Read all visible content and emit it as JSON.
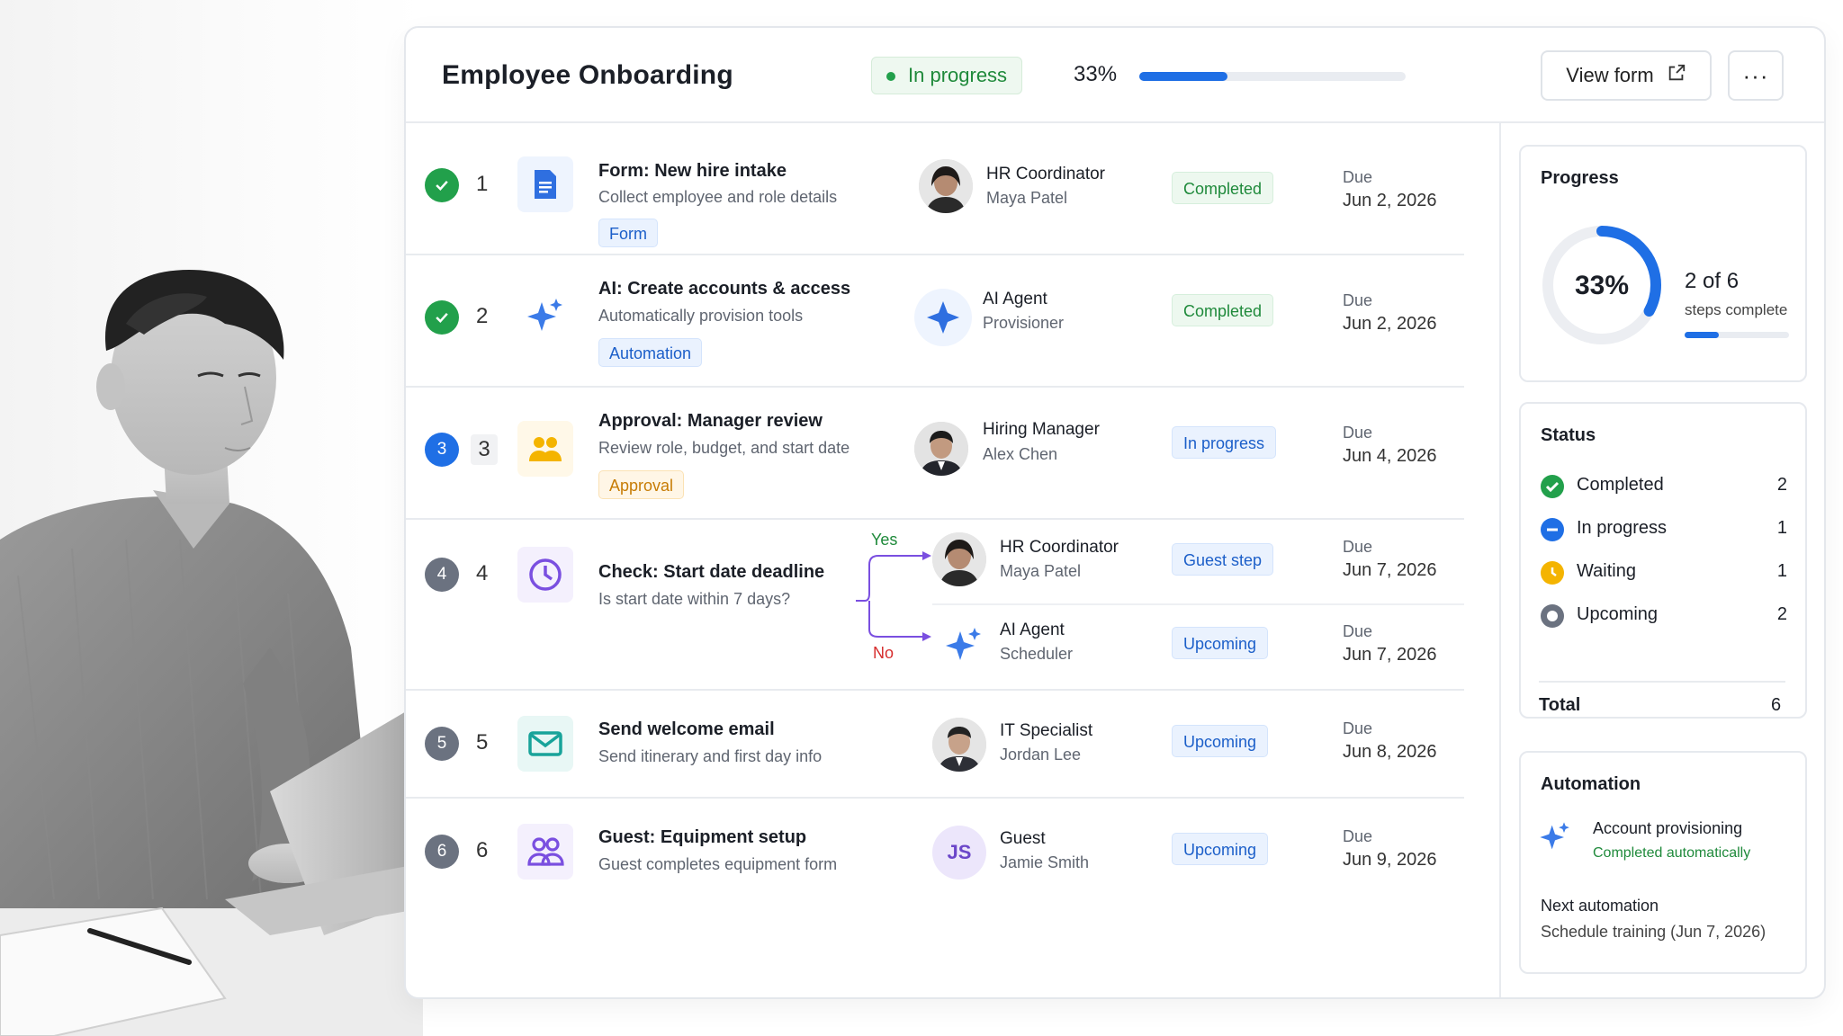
{
  "header": {
    "title": "Employee Onboarding",
    "status": "In progress",
    "progress_text": "33%",
    "progress_value": 0.33,
    "view_form_label": "View form",
    "more_label": "···"
  },
  "steps": [
    {
      "number": "1",
      "state": "completed",
      "title": "Form: New hire intake",
      "desc": "Collect employee and role details",
      "tag": "Form",
      "tag_style": "blue",
      "icon": "document-icon",
      "owner_role": "HR Coordinator",
      "owner_name": "Maya Patel",
      "status": "Completed",
      "due_label": "Due",
      "due_date": "Jun 2, 2026"
    },
    {
      "number": "2",
      "state": "completed",
      "title": "AI: Create accounts & access",
      "desc": "Automatically provision tools",
      "tag": "Automation",
      "tag_style": "blue",
      "icon": "sparkle-icon",
      "owner_role": "AI Agent",
      "owner_name": "Provisioner",
      "status": "Completed",
      "due_label": "Due",
      "due_date": "Jun 2, 2026"
    },
    {
      "number": "3",
      "state": "in-progress",
      "title": "Approval: Manager review",
      "desc": "Review role, budget, and start date",
      "tag": "Approval",
      "tag_style": "amber",
      "icon": "people-icon",
      "owner_role": "Hiring Manager",
      "owner_name": "Alex Chen",
      "status": "In progress",
      "due_label": "Due",
      "due_date": "Jun 4, 2026"
    },
    {
      "number": "4",
      "state": "upcoming",
      "title": "Check: Start date deadline",
      "desc": "Is start date within 7 days?",
      "icon": "clock-icon",
      "branch_yes": "Yes",
      "branch_no": "No",
      "yes": {
        "owner_role": "HR Coordinator",
        "owner_name": "Maya Patel",
        "status": "Guest step",
        "due_label": "Due",
        "due_date": "Jun 7, 2026"
      },
      "no": {
        "owner_role": "AI Agent",
        "owner_name": "Scheduler",
        "status": "Upcoming",
        "due_label": "Due",
        "due_date": "Jun 7, 2026"
      }
    },
    {
      "number": "5",
      "state": "upcoming",
      "title": "Send welcome email",
      "desc": "Send itinerary and first day info",
      "icon": "mail-icon",
      "owner_role": "IT Specialist",
      "owner_name": "Jordan Lee",
      "status": "Upcoming",
      "due_label": "Due",
      "due_date": "Jun 8, 2026"
    },
    {
      "number": "6",
      "state": "upcoming",
      "title": "Guest: Equipment setup",
      "desc": "Guest completes equipment form",
      "icon": "group-icon",
      "owner_role": "Guest",
      "owner_name": "Jamie Smith",
      "owner_initials": "JS",
      "status": "Upcoming",
      "due_label": "Due",
      "due_date": "Jun 9, 2026"
    }
  ],
  "progress_card": {
    "heading": "Progress",
    "percent_text": "33%",
    "percent_value": 0.33,
    "count_text": "2 of 6",
    "count_sub": "steps complete"
  },
  "status_card": {
    "heading": "Status",
    "items": [
      {
        "label": "Completed",
        "count": "2"
      },
      {
        "label": "In progress",
        "count": "1"
      },
      {
        "label": "Waiting",
        "count": "1"
      },
      {
        "label": "Upcoming",
        "count": "2"
      }
    ],
    "total_label": "Total",
    "total_count": "6"
  },
  "automation_card": {
    "heading": "Automation",
    "item_title": "Account provisioning",
    "item_status": "Completed automatically",
    "next_label": "Next automation",
    "next_value": "Schedule training (Jun 7, 2026)"
  },
  "colors": {
    "accent": "#1f6fe5",
    "green": "#22a04b",
    "amber": "#f4b400",
    "purple": "#7a4fe0",
    "teal": "#18a39a",
    "grey": "#6b7280"
  }
}
